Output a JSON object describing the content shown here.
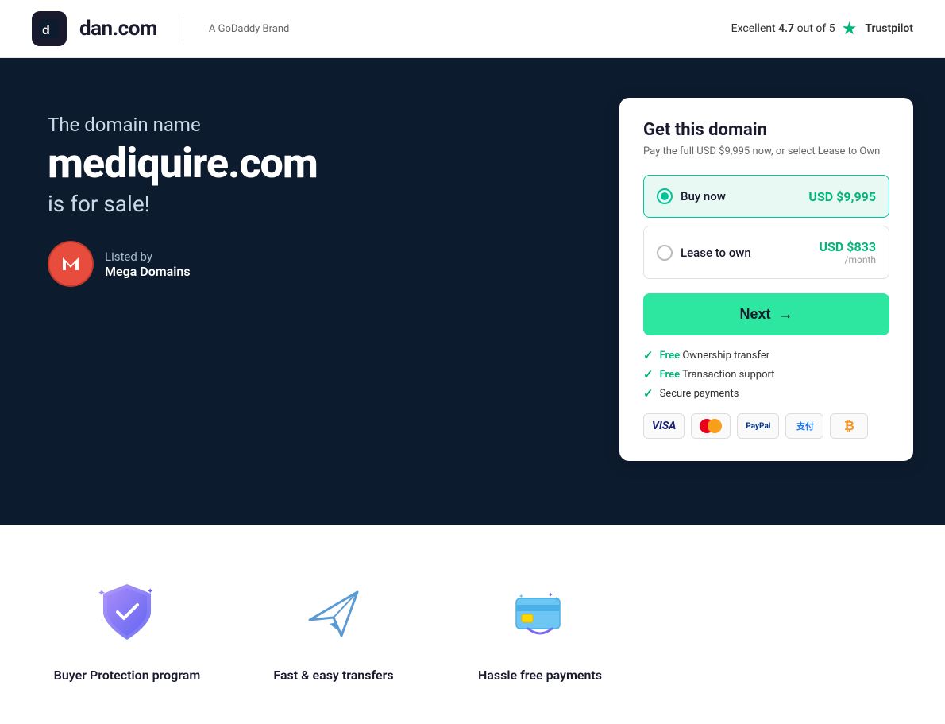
{
  "header": {
    "logo_text": "dan.com",
    "godaddy_label": "A GoDaddy Brand",
    "trustpilot_label": "Excellent",
    "trustpilot_score": "4.7",
    "trustpilot_outof": "out of 5",
    "trustpilot_name": "Trustpilot"
  },
  "hero": {
    "subtitle": "The domain name",
    "domain": "mediquire.com",
    "forsale": "is for sale!",
    "listed_by_label": "Listed by",
    "listed_by_name": "Mega Domains",
    "logo_letter": "M"
  },
  "card": {
    "title": "Get this domain",
    "subtitle": "Pay the full USD $9,995 now, or select Lease to Own",
    "buy_now_label": "Buy now",
    "buy_now_price": "USD $9,995",
    "lease_label": "Lease to own",
    "lease_price": "USD $833",
    "lease_per": "/month",
    "next_label": "Next",
    "free1": "Ownership transfer",
    "free2": "Transaction support",
    "free3": "Secure payments",
    "free_prefix": "Free"
  },
  "features": [
    {
      "id": "buyer-protection",
      "label": "Buyer Protection program"
    },
    {
      "id": "fast-easy",
      "label": "Fast & easy transfers"
    },
    {
      "id": "hassle-free",
      "label": "Hassle free payments"
    }
  ],
  "payment_methods": [
    "VISA",
    "MC",
    "PayPal",
    "Alipay",
    "₿"
  ]
}
